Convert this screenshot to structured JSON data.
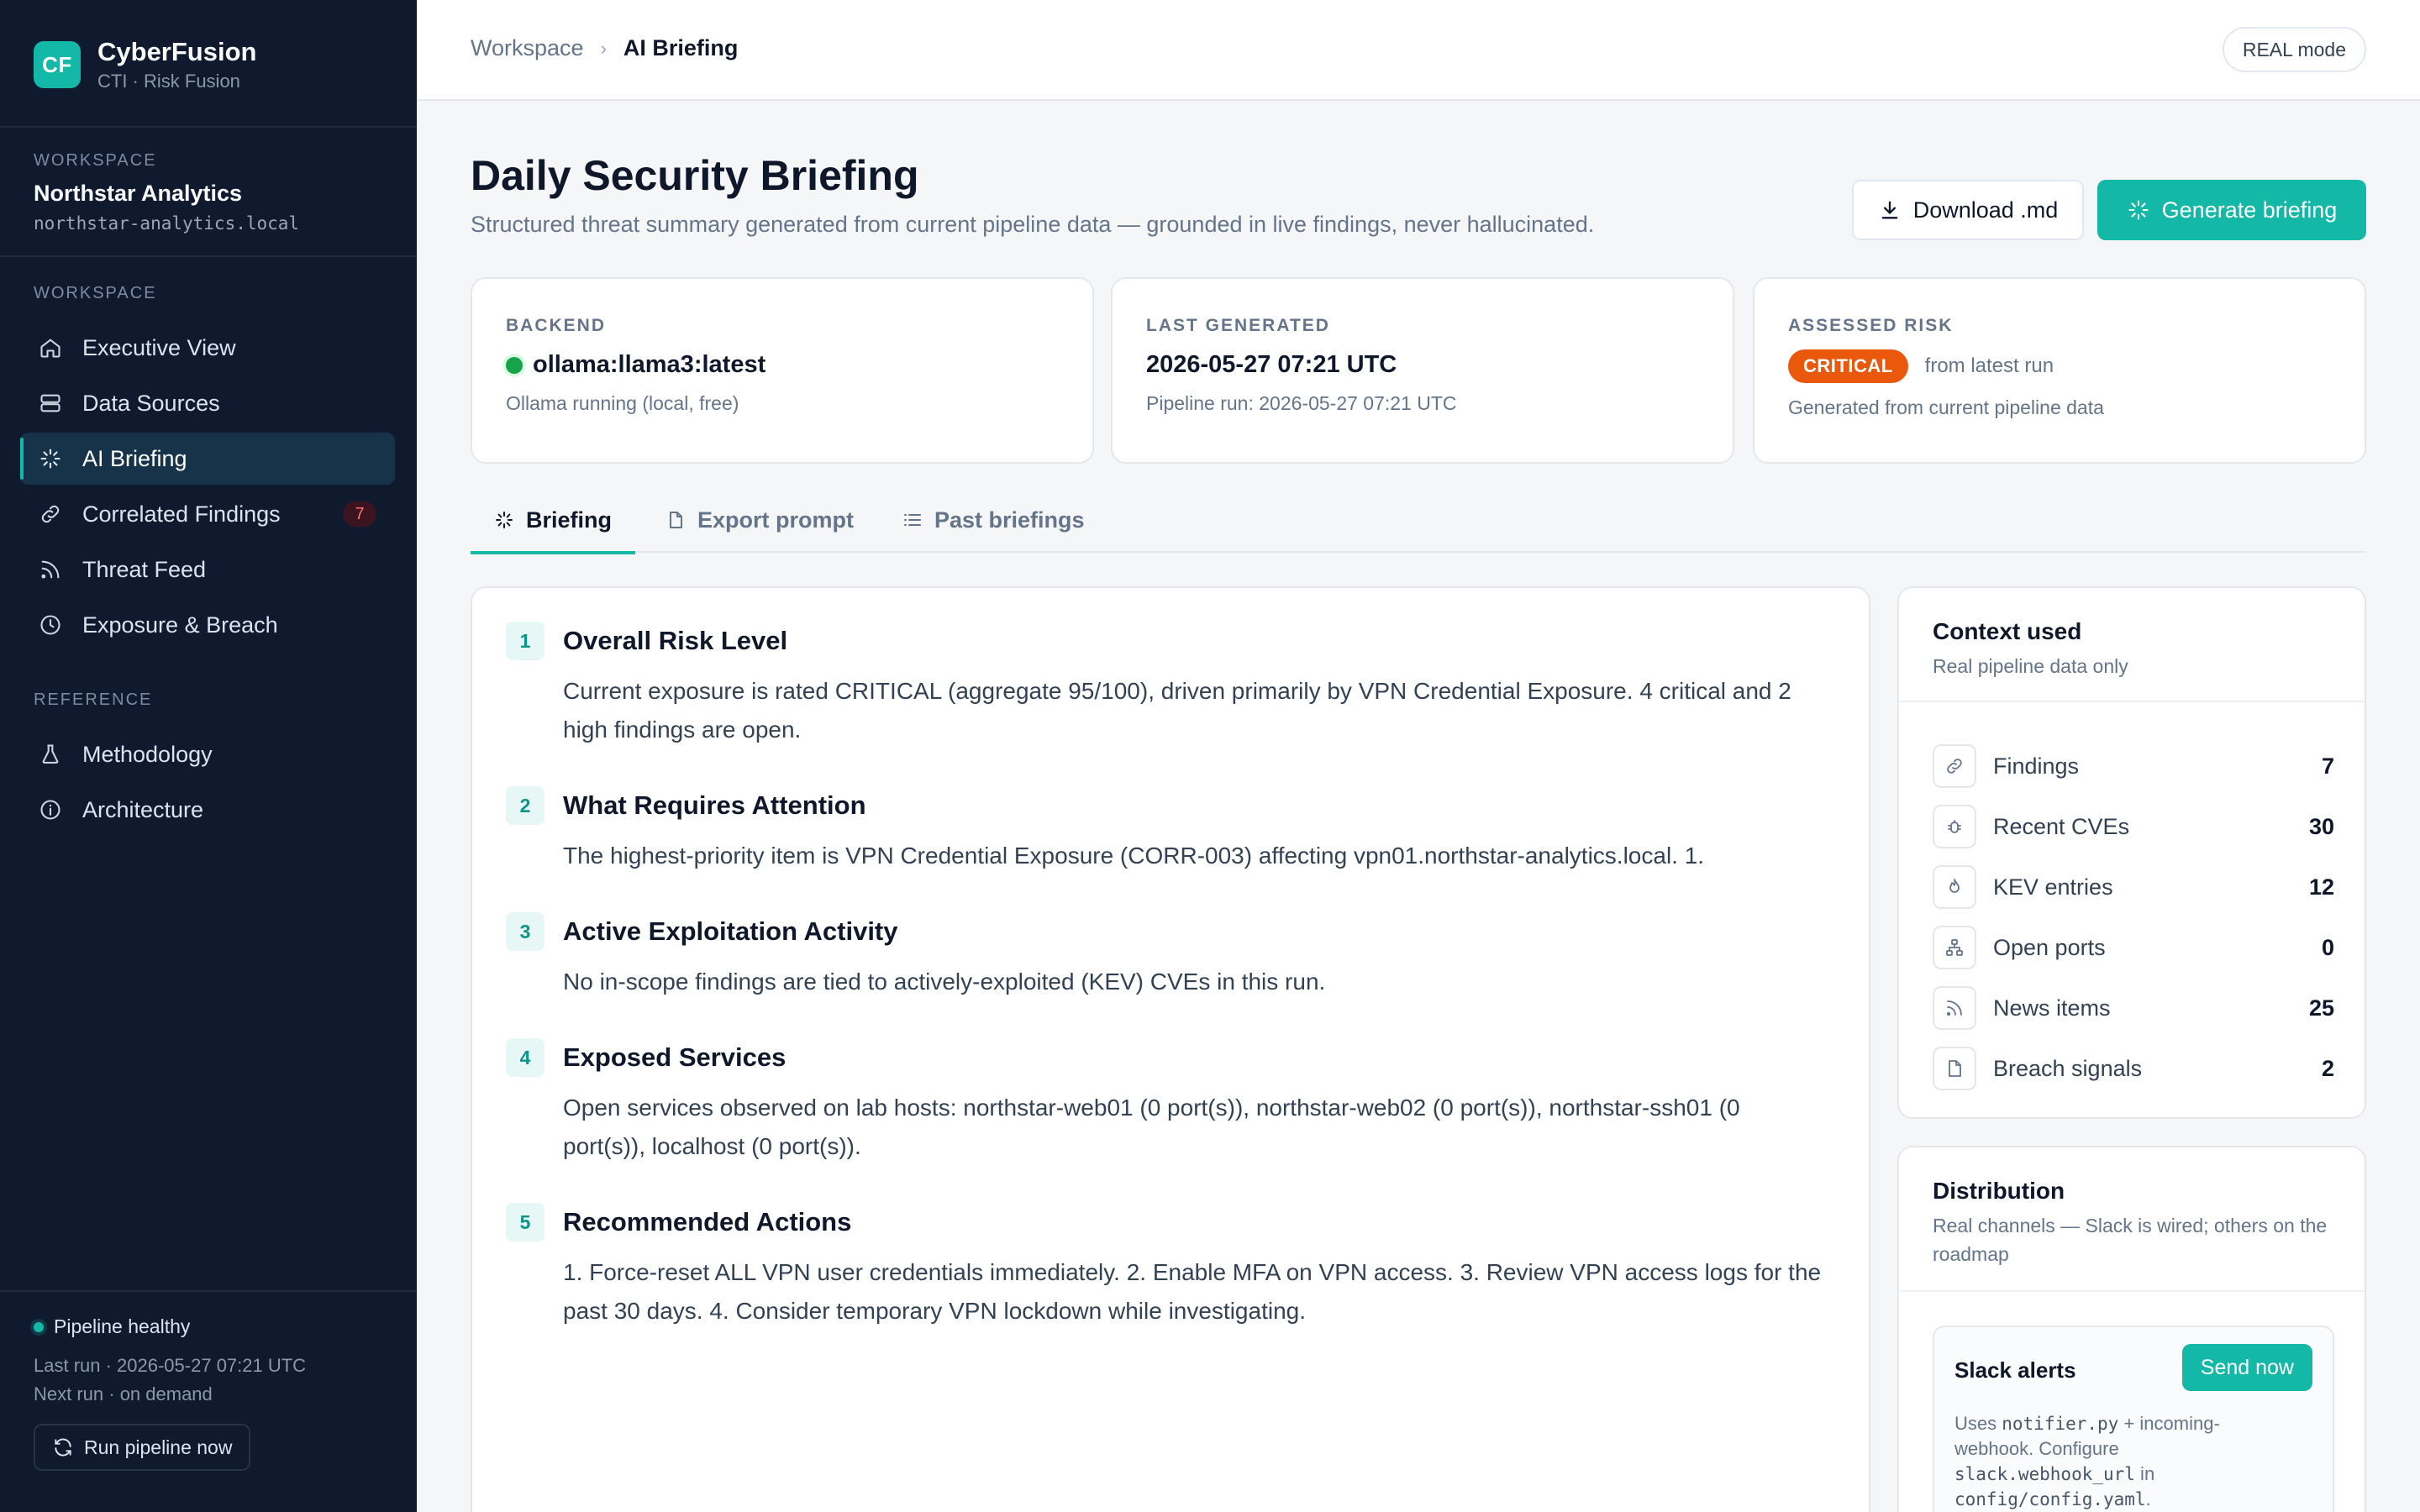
{
  "app": {
    "logo_text": "CF",
    "name": "CyberFusion",
    "tagline": "CTI · Risk Fusion"
  },
  "workspace": {
    "label": "WORKSPACE",
    "name": "Northstar Analytics",
    "domain": "northstar-analytics.local"
  },
  "nav": {
    "section_label": "WORKSPACE",
    "items": [
      {
        "label": "Executive View",
        "icon": "home-icon"
      },
      {
        "label": "Data Sources",
        "icon": "database-icon"
      },
      {
        "label": "AI Briefing",
        "icon": "sparkle-icon",
        "active": true
      },
      {
        "label": "Correlated Findings",
        "icon": "link-icon",
        "badge": "7"
      },
      {
        "label": "Threat Feed",
        "icon": "rss-icon"
      },
      {
        "label": "Exposure & Breach",
        "icon": "clock-icon"
      }
    ],
    "reference_label": "REFERENCE",
    "reference_items": [
      {
        "label": "Methodology",
        "icon": "flask-icon"
      },
      {
        "label": "Architecture",
        "icon": "info-icon"
      }
    ]
  },
  "sidebar_footer": {
    "status": "Pipeline healthy",
    "last_run": "Last run · 2026-05-27 07:21 UTC",
    "next_run": "Next run · on demand",
    "run_button": "Run pipeline now"
  },
  "topbar": {
    "breadcrumb_root": "Workspace",
    "breadcrumb_current": "AI Briefing",
    "mode": "REAL mode"
  },
  "page": {
    "title": "Daily Security Briefing",
    "subtitle": "Structured threat summary generated from current pipeline data — grounded in live findings, never hallucinated.",
    "download_label": "Download .md",
    "generate_label": "Generate briefing"
  },
  "stats": {
    "backend": {
      "label": "BACKEND",
      "value": "ollama:llama3:latest",
      "sub": "Ollama running (local, free)",
      "status_color": "#16a34a"
    },
    "last_generated": {
      "label": "LAST GENERATED",
      "value": "2026-05-27 07:21 UTC",
      "sub": "Pipeline run: 2026-05-27 07:21 UTC"
    },
    "risk": {
      "label": "ASSESSED RISK",
      "badge": "CRITICAL",
      "badge_color": "#ea580c",
      "note": "from latest run",
      "sub": "Generated from current pipeline data"
    }
  },
  "tabs": [
    {
      "label": "Briefing",
      "icon": "sparkle-icon",
      "active": true
    },
    {
      "label": "Export prompt",
      "icon": "file-icon"
    },
    {
      "label": "Past briefings",
      "icon": "list-icon"
    }
  ],
  "briefing": {
    "sections": [
      {
        "num": "1",
        "title": "Overall Risk Level",
        "body": "Current exposure is rated CRITICAL (aggregate 95/100), driven primarily by VPN Credential Exposure. 4 critical and 2 high findings are open."
      },
      {
        "num": "2",
        "title": "What Requires Attention",
        "body": "The highest-priority item is VPN Credential Exposure (CORR-003) affecting vpn01.northstar-analytics.local. 1."
      },
      {
        "num": "3",
        "title": "Active Exploitation Activity",
        "body": "No in-scope findings are tied to actively-exploited (KEV) CVEs in this run."
      },
      {
        "num": "4",
        "title": "Exposed Services",
        "body": "Open services observed on lab hosts: northstar-web01 (0 port(s)), northstar-web02 (0 port(s)), northstar-ssh01 (0 port(s)), localhost (0 port(s))."
      },
      {
        "num": "5",
        "title": "Recommended Actions",
        "body": "1. Force-reset ALL VPN user credentials immediately. 2. Enable MFA on VPN access. 3. Review VPN access logs for the past 30 days. 4. Consider temporary VPN lockdown while investigating."
      }
    ]
  },
  "context": {
    "title": "Context used",
    "subtitle": "Real pipeline data only",
    "items": [
      {
        "label": "Findings",
        "value": "7",
        "icon": "link-icon"
      },
      {
        "label": "Recent CVEs",
        "value": "30",
        "icon": "bug-icon"
      },
      {
        "label": "KEV entries",
        "value": "12",
        "icon": "flame-icon"
      },
      {
        "label": "Open ports",
        "value": "0",
        "icon": "network-icon"
      },
      {
        "label": "News items",
        "value": "25",
        "icon": "rss-icon"
      },
      {
        "label": "Breach signals",
        "value": "2",
        "icon": "file-icon"
      }
    ]
  },
  "distribution": {
    "title": "Distribution",
    "subtitle": "Real channels — Slack is wired; others on the roadmap",
    "slack": {
      "title": "Slack alerts",
      "button": "Send now",
      "desc_1": "Uses ",
      "code_1": "notifier.py",
      "desc_2": " + incoming-webhook. Configure ",
      "code_2": "slack.webhook_url",
      "desc_3": " in ",
      "code_3": "config/config.yaml",
      "desc_4": "."
    }
  }
}
